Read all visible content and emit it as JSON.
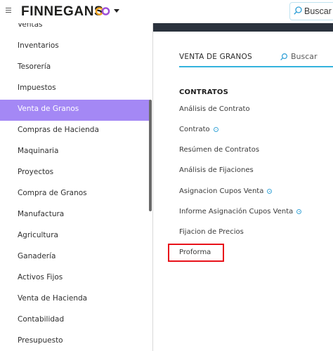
{
  "topbar": {
    "brand": "FINNEGANS",
    "search_label": "Buscar"
  },
  "sidebar": {
    "items": [
      {
        "label": "Ventas",
        "active": false
      },
      {
        "label": "Inventarios",
        "active": false
      },
      {
        "label": "Tesorería",
        "active": false
      },
      {
        "label": "Impuestos",
        "active": false
      },
      {
        "label": "Venta de Granos",
        "active": true
      },
      {
        "label": "Compras de Hacienda",
        "active": false
      },
      {
        "label": "Maquinaria",
        "active": false
      },
      {
        "label": "Proyectos",
        "active": false
      },
      {
        "label": "Compra de Granos",
        "active": false
      },
      {
        "label": "Manufactura",
        "active": false
      },
      {
        "label": "Agricultura",
        "active": false
      },
      {
        "label": "Ganadería",
        "active": false
      },
      {
        "label": "Activos Fijos",
        "active": false
      },
      {
        "label": "Venta de Hacienda",
        "active": false
      },
      {
        "label": "Contabilidad",
        "active": false
      },
      {
        "label": "Presupuesto",
        "active": false
      }
    ]
  },
  "main": {
    "module_title": "VENTA DE GRANOS",
    "search_label": "Buscar",
    "section_heading": "CONTRATOS",
    "links": [
      {
        "label": "Análisis de Contrato",
        "info": false
      },
      {
        "label": "Contrato",
        "info": true
      },
      {
        "label": "Resúmen de Contratos",
        "info": false
      },
      {
        "label": "Análisis de Fijaciones",
        "info": false
      },
      {
        "label": "Asignacion Cupos Venta",
        "info": true
      },
      {
        "label": "Informe Asignación Cupos Venta",
        "info": true
      },
      {
        "label": "Fijacion de Precios",
        "info": false
      },
      {
        "label": "Proforma",
        "info": false,
        "highlighted": true
      }
    ]
  },
  "colors": {
    "active_item": "#a488f5",
    "accent_underline": "#33b3dd",
    "highlight_border": "#e8121a",
    "dark_strip": "#2b323d"
  },
  "icons": [
    "hamburger-icon",
    "finnegans-logo-icon",
    "chevron-down-icon",
    "search-icon",
    "info-icon"
  ]
}
